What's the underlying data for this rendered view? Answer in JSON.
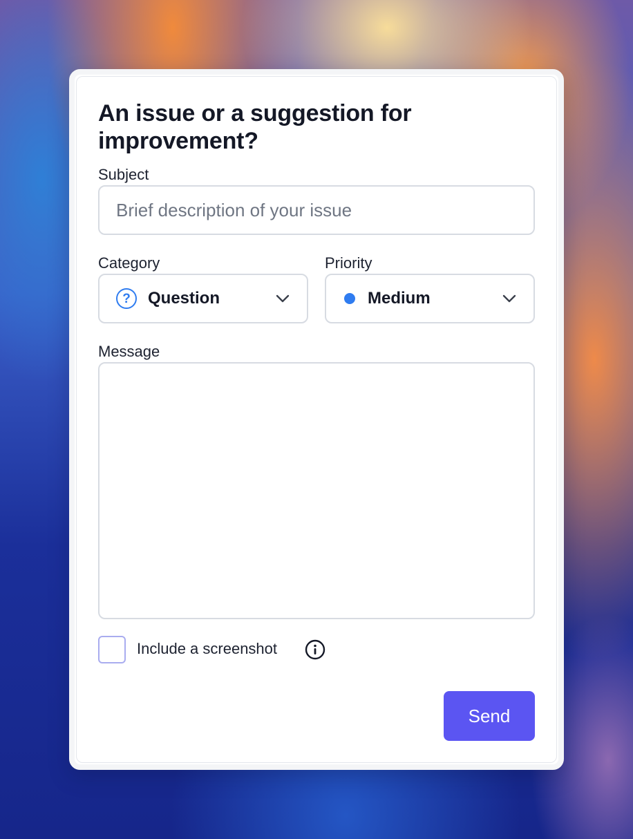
{
  "dialog": {
    "title": "An issue or a suggestion for improvement?"
  },
  "subject": {
    "label": "Subject",
    "placeholder": "Brief description of your issue",
    "value": ""
  },
  "category": {
    "label": "Category",
    "selected": "Question",
    "icon": "question-circle-icon"
  },
  "priority": {
    "label": "Priority",
    "selected": "Medium",
    "indicator_color": "#2f7cf0"
  },
  "message": {
    "label": "Message",
    "value": ""
  },
  "screenshot_option": {
    "label": "Include a screenshot",
    "checked": false,
    "icon": "info-icon"
  },
  "actions": {
    "send_label": "Send",
    "send_color": "#5b55f2"
  }
}
